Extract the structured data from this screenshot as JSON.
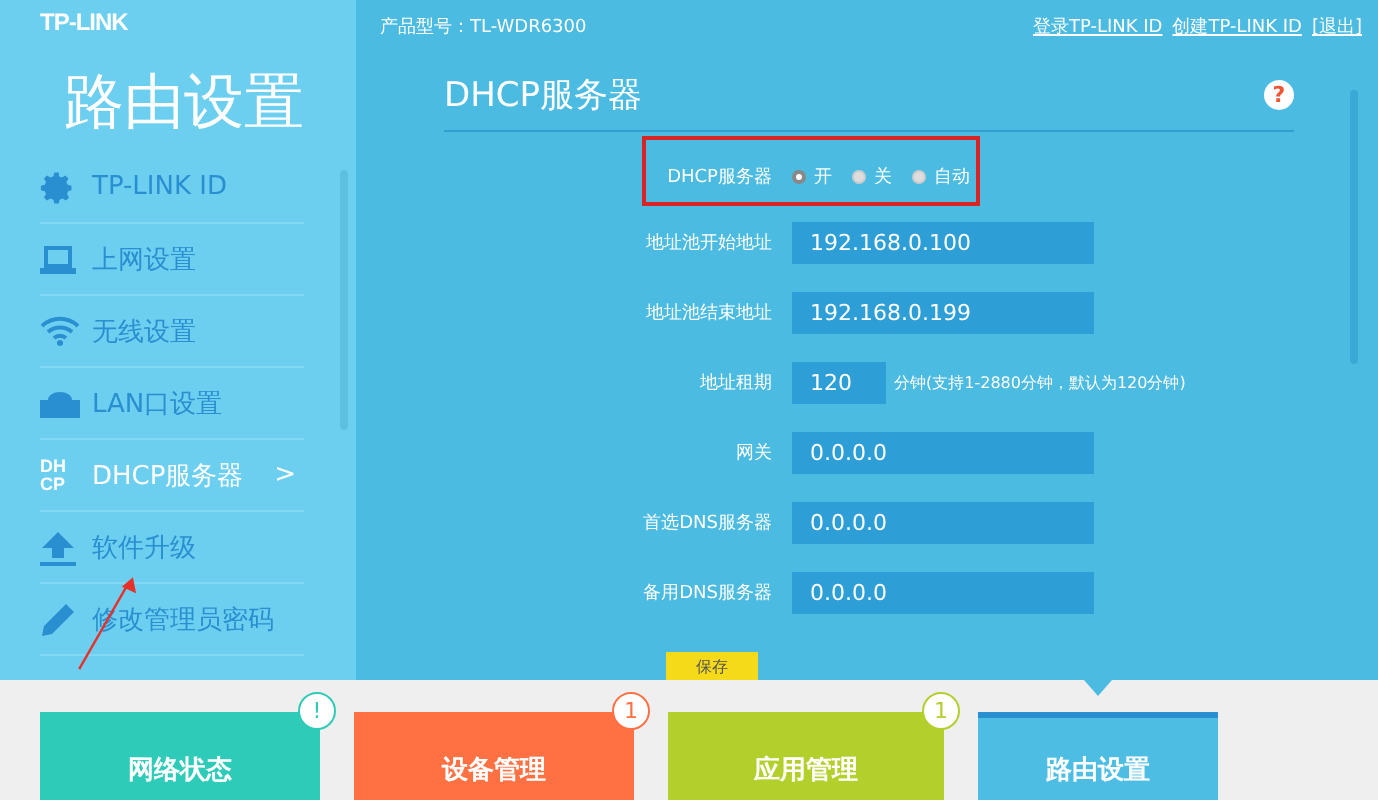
{
  "header": {
    "logo": "TP-LINK",
    "model": "产品型号：TL-WDR6300",
    "links": [
      "登录TP-LINK ID",
      "创建TP-LINK ID",
      "[退出]"
    ]
  },
  "sidebar": {
    "title": "路由设置",
    "items": [
      {
        "kind": "gear",
        "label": "TP-LINK ID",
        "selected": false
      },
      {
        "kind": "laptop",
        "label": "上网设置",
        "selected": false
      },
      {
        "kind": "wifi",
        "label": "无线设置",
        "selected": false
      },
      {
        "kind": "router",
        "label": "LAN口设置",
        "selected": false
      },
      {
        "kind": "dhcp",
        "label": "DHCP服务器",
        "selected": true,
        "chevron": ">",
        "icon_text": [
          "DH",
          "CP"
        ]
      },
      {
        "kind": "upload",
        "label": "软件升级",
        "selected": false
      },
      {
        "kind": "pencil",
        "label": "修改管理员密码",
        "selected": false
      }
    ]
  },
  "panel": {
    "title": "DHCP服务器",
    "help": "?",
    "server": {
      "label": "DHCP服务器",
      "options": [
        {
          "label": "开",
          "selected": true
        },
        {
          "label": "关",
          "selected": false
        },
        {
          "label": "自动",
          "selected": false
        }
      ]
    },
    "fields": [
      {
        "label": "地址池开始地址",
        "value": "192.168.0.100",
        "kind": "wide"
      },
      {
        "label": "地址池结束地址",
        "value": "192.168.0.199",
        "kind": "wide"
      },
      {
        "label": "地址租期",
        "value": "120",
        "kind": "short",
        "hint": "分钟(支持1-2880分钟，默认为120分钟)"
      },
      {
        "label": "网关",
        "value": "0.0.0.0",
        "kind": "wide"
      },
      {
        "label": "首选DNS服务器",
        "value": "0.0.0.0",
        "kind": "wide"
      },
      {
        "label": "备用DNS服务器",
        "value": "0.0.0.0",
        "kind": "wide"
      }
    ],
    "save": "保存"
  },
  "tiles": [
    {
      "label": "网络状态",
      "color": "#2ecbb8",
      "badge": "!",
      "selected": false
    },
    {
      "label": "设备管理",
      "color": "#ff7043",
      "badge": "1",
      "selected": false
    },
    {
      "label": "应用管理",
      "color": "#b3cf2b",
      "badge": "1",
      "selected": false
    },
    {
      "label": "路由设置",
      "color": "#4dbde4",
      "selected": true
    }
  ]
}
